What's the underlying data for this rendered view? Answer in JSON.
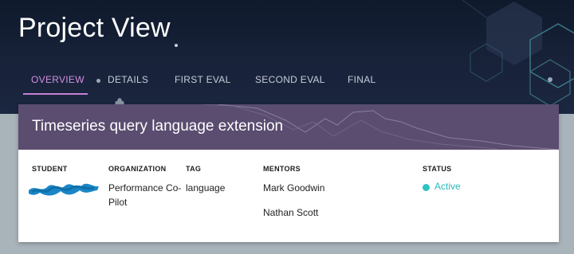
{
  "header": {
    "title": "Project View"
  },
  "tabs": [
    {
      "label": "OVERVIEW",
      "active": true
    },
    {
      "label": "DETAILS",
      "active": false
    },
    {
      "label": "FIRST EVAL",
      "active": false
    },
    {
      "label": "SECOND EVAL",
      "active": false
    },
    {
      "label": "FINAL",
      "active": false
    }
  ],
  "project": {
    "title": "Timeseries query language extension",
    "columns": {
      "student": "STUDENT",
      "organization": "ORGANIZATION",
      "tag": "TAG",
      "mentors": "MENTORS",
      "status": "STATUS"
    },
    "organization_line1": "Performance Co-",
    "organization_line2": "Pilot",
    "tag": "language",
    "mentors": [
      "Mark Goodwin",
      "Nathan Scott"
    ],
    "status": "Active"
  },
  "colors": {
    "accent": "#c77fd6",
    "header_bg": "#5a4d70",
    "status_active": "#2cc3c3",
    "redaction": "#1a86c8"
  },
  "icons": [
    "gear-icon",
    "status-dot-icon"
  ]
}
